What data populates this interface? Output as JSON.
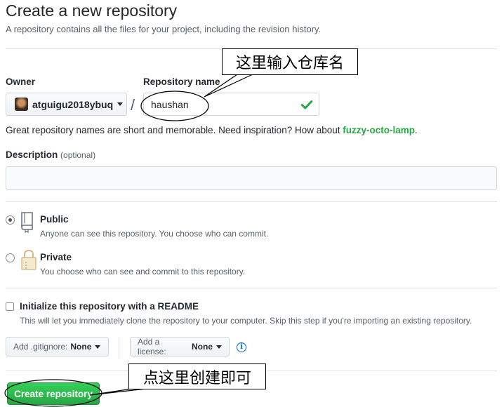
{
  "header": {
    "title": "Create a new repository",
    "subtitle": "A repository contains all the files for your project, including the revision history."
  },
  "owner": {
    "label": "Owner",
    "name": "atguigu2018ybuq"
  },
  "separator": "/",
  "repo": {
    "label": "Repository name",
    "value": "haushan"
  },
  "hint": {
    "text": "Great repository names are short and memorable. Need inspiration? How about ",
    "suggestion": "fuzzy-octo-lamp",
    "end": "."
  },
  "description": {
    "label": "Description",
    "optional": "(optional)",
    "value": ""
  },
  "visibility": {
    "public": {
      "title": "Public",
      "desc": "Anyone can see this repository. You choose who can commit.",
      "selected": true
    },
    "private": {
      "title": "Private",
      "desc": "You choose who can see and commit to this repository.",
      "selected": false
    }
  },
  "readme": {
    "label": "Initialize this repository with a README",
    "desc": "This will let you immediately clone the repository to your computer. Skip this step if you're importing an existing repository.",
    "checked": false
  },
  "gitignore": {
    "prefix": "Add .gitignore:",
    "value": "None"
  },
  "license": {
    "prefix": "Add a license:",
    "value": "None"
  },
  "create_button": "Create repository",
  "annotations": {
    "repo_callout": "这里输入仓库名",
    "create_callout": "点这里创建即可"
  },
  "colors": {
    "accent_green": "#28a745",
    "link_blue": "#0366d6"
  },
  "icons": [
    "checkmark-icon",
    "book-icon",
    "lock-icon",
    "info-icon",
    "caret-down-icon"
  ]
}
